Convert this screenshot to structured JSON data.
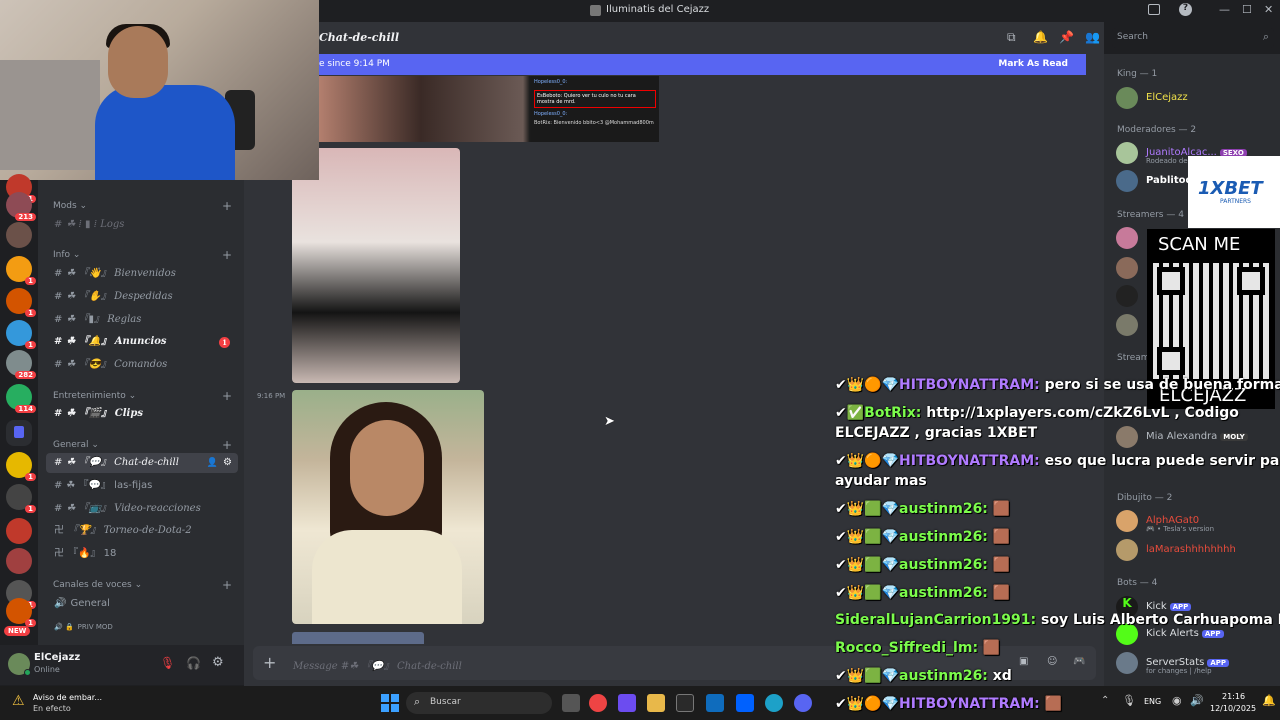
{
  "window": {
    "title": "Iluminatis del Cejazz",
    "minimize": "—",
    "maximize": "☐",
    "close": "✕"
  },
  "colors": {
    "accent": "#5865f2",
    "mention_badge": "#f23f43",
    "online": "#23a55a"
  },
  "servers": {
    "badges": [
      "821",
      "213",
      "1",
      "1",
      "1",
      "282",
      "114",
      "1",
      "1",
      "291",
      "1"
    ],
    "new_label": "NEW"
  },
  "sidebar": {
    "categories": [
      {
        "label": "Mods",
        "channels": [
          {
            "label": "Logs",
            "prefix": "⁞",
            "emoji": "▮"
          }
        ]
      },
      {
        "label": "Info",
        "channels": [
          {
            "label": "Bienvenidos",
            "emoji": "👋"
          },
          {
            "label": "Despedidas",
            "emoji": "✋"
          },
          {
            "label": "Reglas",
            "emoji": "▮"
          },
          {
            "label": "Anuncios",
            "emoji": "🔔",
            "badge": "1"
          },
          {
            "label": "Comandos",
            "emoji": "😎"
          }
        ]
      },
      {
        "label": "Entretenimiento",
        "channels": [
          {
            "label": "Clips",
            "emoji": "🎬"
          }
        ]
      },
      {
        "label": "General",
        "channels": [
          {
            "label": "Chat-de-chill",
            "emoji": "💬"
          },
          {
            "label": "las-fijas",
            "emoji": "💬"
          },
          {
            "label": "Video-reacciones",
            "emoji": "📺"
          },
          {
            "label": "Torneo-de-Dota-2",
            "emoji": "🏆"
          },
          {
            "label": "18",
            "emoji": "🔥"
          }
        ]
      },
      {
        "label": "Canales de voces",
        "channels": [
          {
            "label": "General"
          },
          {
            "label": "PRIV MOD"
          }
        ]
      }
    ]
  },
  "user": {
    "name": "ElCejazz",
    "status": "Online"
  },
  "header": {
    "channel": "Chat-de-chill"
  },
  "newbar": {
    "text": "e since 9:14 PM",
    "action": "Mark As Read"
  },
  "messages": {
    "timestamp": "9:16 PM",
    "embed_lines": [
      "Hopeless0_0:",
      "EsBeboto: Quiero ver tu culo no tu cara mostra de mrd.",
      "Hopeless0_0:",
      "BotRix: Bienvenido bbito<3 @Mohammad800m"
    ]
  },
  "composer": {
    "placeholder": "Message #☘ 『💬』 Chat-de-chill"
  },
  "search": {
    "placeholder": "Search"
  },
  "members": {
    "groups": [
      {
        "label": "King — 1"
      },
      {
        "label": "Moderadores — 2"
      },
      {
        "label": "Streamers — 4"
      },
      {
        "label": "Stream"
      },
      {
        "label": "Dibujito — 2"
      },
      {
        "label": "Bots — 4"
      }
    ],
    "list": [
      {
        "name": "ElCejazz",
        "color": "#f0e14a"
      },
      {
        "name": "JuanitoAlcac...",
        "sub": "Rodeado de...",
        "color": "#b07bff",
        "tag": "SEXO"
      },
      {
        "name": "Pablitode",
        "color": "#ffffff"
      },
      {
        "name": "Mia Alexandra",
        "color": "#b5bac1",
        "tag": "MOLY"
      },
      {
        "name": "AlphAGat0",
        "sub": "🎮 • Tesla's version",
        "color": "#e74c3c"
      },
      {
        "name": "laMarashhhhhhhh",
        "color": "#e74c3c"
      },
      {
        "name": "Kick",
        "color": "#dbdee1",
        "tag": "APP"
      },
      {
        "name": "Kick Alerts",
        "color": "#dbdee1",
        "tag": "APP"
      },
      {
        "name": "ServerStats",
        "sub": "for changes | /help",
        "color": "#dbdee1",
        "tag": "APP"
      }
    ]
  },
  "ad": {
    "brand": "1XBET",
    "partners": "PARTNERS",
    "scan": "SCAN ME",
    "name": "ELCEJAZZ"
  },
  "overlay_chat": [
    {
      "user": "HITBOYNATTRAM:",
      "text": "pero si se usa de buena forma"
    },
    {
      "user": "BotRix:",
      "text": "http://1xplayers.com/cZkZ6LvL , Codigo"
    },
    {
      "user": "",
      "text": "ELCEJAZZ , gracias 1XBET"
    },
    {
      "user": "HITBOYNATTRAM:",
      "text": "eso que lucra puede servir para"
    },
    {
      "user": "",
      "text": "ayudar mas"
    },
    {
      "user": "austinm26:",
      "text": ""
    },
    {
      "user": "austinm26:",
      "text": ""
    },
    {
      "user": "austinm26:",
      "text": ""
    },
    {
      "user": "austinm26:",
      "text": ""
    },
    {
      "user": "SideralLujanCarrion1991:",
      "text": "soy Luis Alberto Carhuapoma Roca"
    },
    {
      "user": "Rocco_Siffredi_lm:",
      "text": ""
    },
    {
      "user": "austinm26:",
      "text": "xd"
    },
    {
      "user": "HITBOYNATTRAM:",
      "text": ""
    }
  ],
  "taskbar": {
    "notify_title": "Aviso de embar...",
    "notify_sub": "En efecto",
    "search": "Buscar",
    "lang": "ENG",
    "time": "21:16",
    "date": "12/10/2025"
  }
}
